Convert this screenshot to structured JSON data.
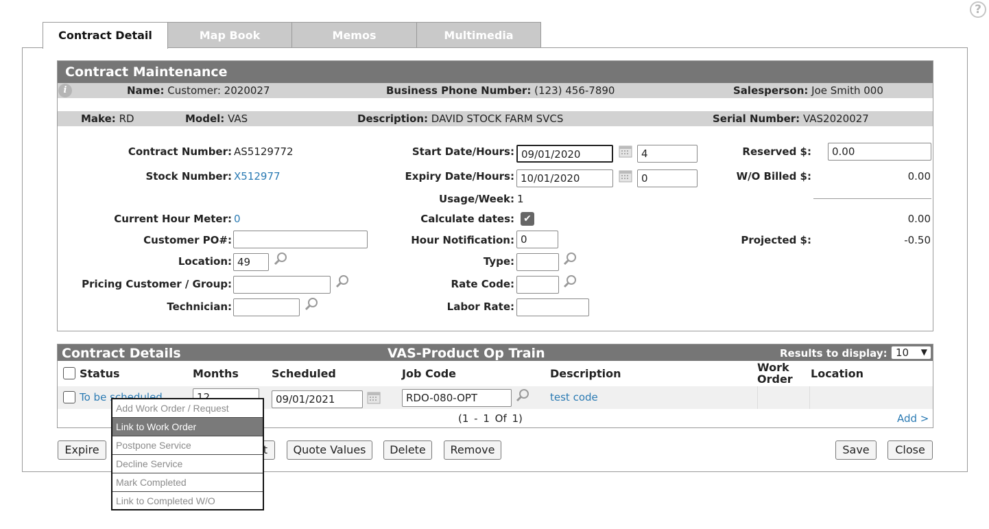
{
  "help_icon": "question-icon",
  "tabs": [
    {
      "label": "Contract Detail"
    },
    {
      "label": "Map Book"
    },
    {
      "label": "Memos"
    },
    {
      "label": "Multimedia"
    }
  ],
  "maintenance": {
    "title": "Contract Maintenance",
    "info_icon": "info-icon",
    "name_label": "Name:",
    "name_value": "Customer: 2020027",
    "phone_label": "Business Phone Number:",
    "phone_value": "(123) 456-7890",
    "salesperson_label": "Salesperson:",
    "salesperson_value": "Joe Smith 000",
    "make_label": "Make:",
    "make_value": "RD",
    "model_label": "Model:",
    "model_value": "VAS",
    "description_label": "Description:",
    "description_value": "DAVID STOCK FARM SVCS",
    "serial_label": "Serial Number:",
    "serial_value": "VAS2020027"
  },
  "form": {
    "contract_number_label": "Contract Number:",
    "contract_number_value": "AS5129772",
    "stock_number_label": "Stock Number:",
    "stock_number_value": "X512977",
    "current_hour_meter_label": "Current Hour Meter:",
    "current_hour_meter_value": "0",
    "customer_po_label": "Customer PO#:",
    "customer_po_value": "",
    "location_label": "Location:",
    "location_value": "49",
    "pricing_label": "Pricing Customer / Group:",
    "pricing_value": "",
    "technician_label": "Technician:",
    "technician_value": "",
    "start_label": "Start Date/Hours:",
    "start_date": "09/01/2020",
    "start_hours": "4",
    "expiry_label": "Expiry Date/Hours:",
    "expiry_date": "10/01/2020",
    "expiry_hours": "0",
    "usage_label": "Usage/Week:",
    "usage_value": "1",
    "calculate_label": "Calculate dates:",
    "calculate_checked": true,
    "hour_notification_label": "Hour Notification:",
    "hour_notification_value": "0",
    "type_label": "Type:",
    "type_value": "",
    "rate_code_label": "Rate Code:",
    "rate_code_value": "",
    "labor_rate_label": "Labor Rate:",
    "labor_rate_value": "",
    "reserved_label": "Reserved $:",
    "reserved_value": "0.00",
    "wo_billed_label": "W/O Billed $:",
    "wo_billed_value": "0.00",
    "subtotal_value": "0.00",
    "projected_label": "Projected $:",
    "projected_value": "-0.50"
  },
  "details": {
    "title": "Contract Details",
    "center_title": "VAS-Product Op Train",
    "results_label": "Results to display:",
    "results_value": "10",
    "columns": {
      "status": "Status",
      "months": "Months",
      "scheduled": "Scheduled",
      "job_code": "Job Code",
      "description": "Description",
      "work_order": "Work Order",
      "location": "Location"
    },
    "row": {
      "status": "To be scheduled",
      "months": "12",
      "scheduled": "09/01/2021",
      "job_code": "RDO-080-OPT",
      "description": "test code",
      "work_order": "",
      "location": ""
    },
    "pagination": "(1 - 1 Of 1)",
    "add_link": "Add >"
  },
  "buttons": {
    "expire": "Expire",
    "hidden_partial": "t",
    "quote_values": "Quote Values",
    "delete": "Delete",
    "remove": "Remove",
    "save": "Save",
    "close": "Close"
  },
  "context_menu": [
    {
      "label": "Add Work Order / Request",
      "selected": false
    },
    {
      "label": "Link to Work Order",
      "selected": true
    },
    {
      "label": "Postpone Service",
      "selected": false
    },
    {
      "label": "Decline Service",
      "selected": false
    },
    {
      "label": "Mark Completed",
      "selected": false
    },
    {
      "label": "Link to Completed W/O",
      "selected": false
    }
  ],
  "colors": {
    "header_bar": "#767676",
    "gray_row": "#d2d2d2",
    "link": "#2a7ab3",
    "menu_selected": "#7a7a7a"
  }
}
